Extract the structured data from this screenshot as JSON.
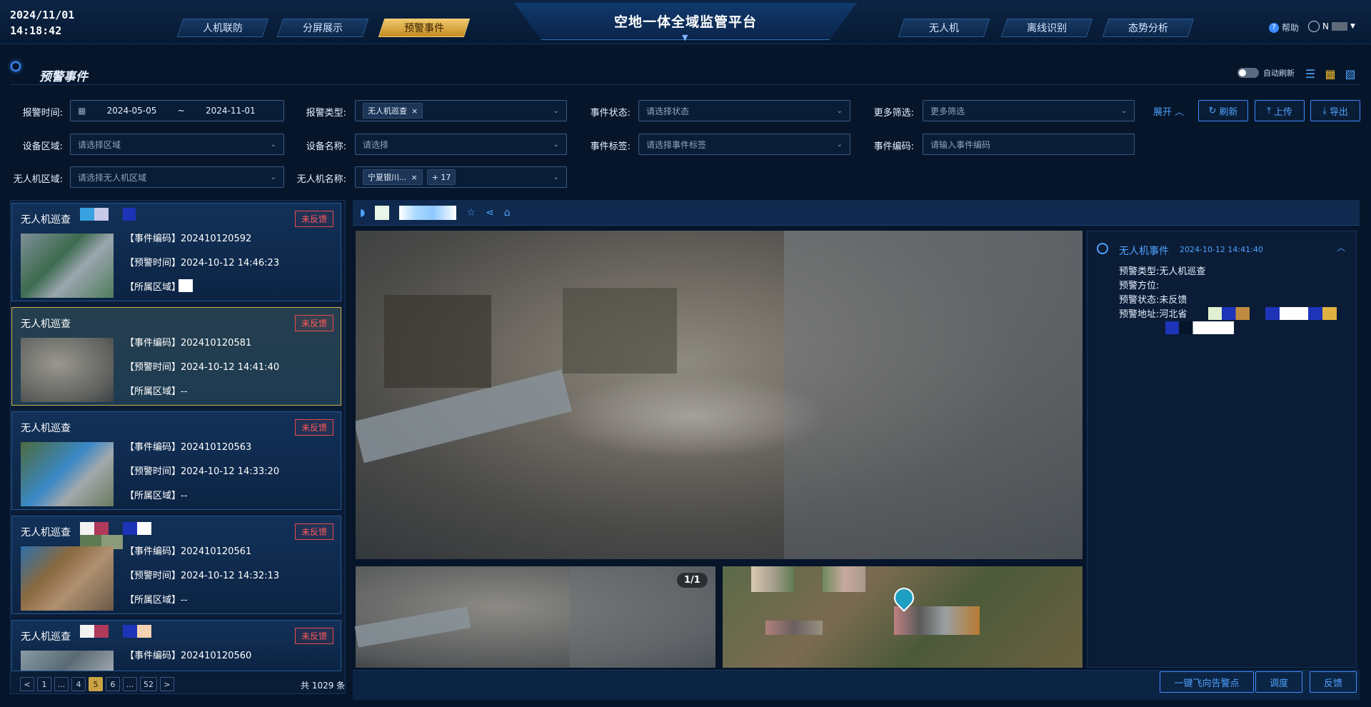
{
  "header": {
    "date": "2024/11/01",
    "time": "14:18:42",
    "title": "空地一体全域监管平台",
    "left_tabs": [
      "人机联防",
      "分屏展示",
      "预警事件"
    ],
    "right_tabs": [
      "无人机",
      "离线识别",
      "态势分析"
    ],
    "active_tab": "预警事件",
    "help": "帮助",
    "user": "N"
  },
  "page": {
    "section_title": "预警事件",
    "auto_refresh": "自动刷新",
    "auto_refresh_on": false
  },
  "filters": {
    "alarm_time_label": "报警时间:",
    "date_start": "2024-05-05",
    "date_sep": "~",
    "date_end": "2024-11-01",
    "alarm_type_label": "报警类型:",
    "alarm_type_chip": "无人机巡查",
    "event_status_label": "事件状态:",
    "event_status_placeholder": "请选择状态",
    "more_filter_label": "更多筛选:",
    "more_filter_placeholder": "更多筛选",
    "device_area_label": "设备区域:",
    "device_area_placeholder": "请选择区域",
    "device_name_label": "设备名称:",
    "device_name_placeholder": "请选择",
    "event_tag_label": "事件标签:",
    "event_tag_placeholder": "请选择事件标签",
    "event_code_label": "事件编码:",
    "event_code_placeholder": "请输入事件编码",
    "drone_area_label": "无人机区域:",
    "drone_area_placeholder": "请选择无人机区域",
    "drone_name_label": "无人机名称:",
    "drone_name_chip": "宁夏银川...",
    "drone_name_more": "+ 17",
    "expand": "展开",
    "refresh": "刷新",
    "upload": "上传",
    "export": "导出"
  },
  "events": [
    {
      "title": "无人机巡查",
      "status": "未反馈",
      "code_label": "【事件编码】",
      "code": "202410120592",
      "time_label": "【预警时间】",
      "time": "2024-10-12 14:46:23",
      "area_label": "【所属区域】",
      "area": ""
    },
    {
      "title": "无人机巡查",
      "status": "未反馈",
      "code_label": "【事件编码】",
      "code": "202410120581",
      "time_label": "【预警时间】",
      "time": "2024-10-12 14:41:40",
      "area_label": "【所属区域】",
      "area": "--"
    },
    {
      "title": "无人机巡查",
      "status": "未反馈",
      "code_label": "【事件编码】",
      "code": "202410120563",
      "time_label": "【预警时间】",
      "time": "2024-10-12 14:33:20",
      "area_label": "【所属区域】",
      "area": "--"
    },
    {
      "title": "无人机巡查",
      "status": "未反馈",
      "code_label": "【事件编码】",
      "code": "202410120561",
      "time_label": "【预警时间】",
      "time": "2024-10-12 14:32:13",
      "area_label": "【所属区域】",
      "area": "--"
    },
    {
      "title": "无人机巡查",
      "status": "未反馈",
      "code_label": "【事件编码】",
      "code": "202410120560",
      "time_label": "",
      "time": "",
      "area_label": "",
      "area": ""
    }
  ],
  "pagination": {
    "prev": "<",
    "pages": [
      "1",
      "...",
      "4",
      "5",
      "6",
      "...",
      "52"
    ],
    "current": "5",
    "next": ">",
    "total": "共 1029 条"
  },
  "viewer": {
    "counter": "1/1"
  },
  "detail": {
    "title": "无人机事件",
    "time": "2024-10-12 14:41:40",
    "type_label": "预警类型:",
    "type": "无人机巡查",
    "direction_label": "预警方位:",
    "direction": "",
    "status_label": "预警状态:",
    "status": "未反馈",
    "address_label": "预警地址:",
    "address": "河北省"
  },
  "actions": {
    "fly_to_point": "一键飞向告警点",
    "dispatch": "调度",
    "feedback": "反馈"
  }
}
